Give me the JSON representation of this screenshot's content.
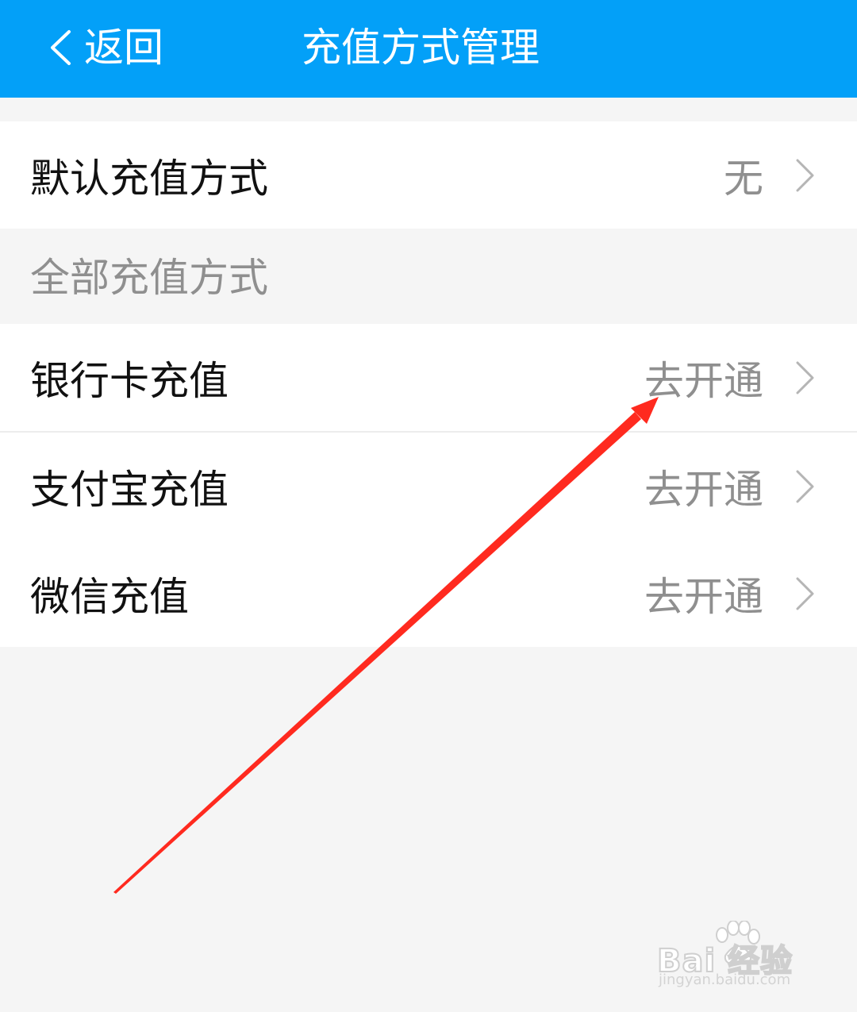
{
  "header": {
    "back_label": "返回",
    "title": "充值方式管理",
    "background_color": "#03a0f8"
  },
  "default_method": {
    "label": "默认充值方式",
    "value": "无"
  },
  "section": {
    "label": "全部充值方式"
  },
  "methods": [
    {
      "label": "银行卡充值",
      "action": "去开通"
    },
    {
      "label": "支付宝充值",
      "action": "去开通"
    },
    {
      "label": "微信充值",
      "action": "去开通"
    }
  ],
  "annotation": {
    "arrow_color": "#ff2a1f"
  },
  "watermark": {
    "brand": "Bai 经验",
    "url": "jingyan.baidu.com"
  }
}
